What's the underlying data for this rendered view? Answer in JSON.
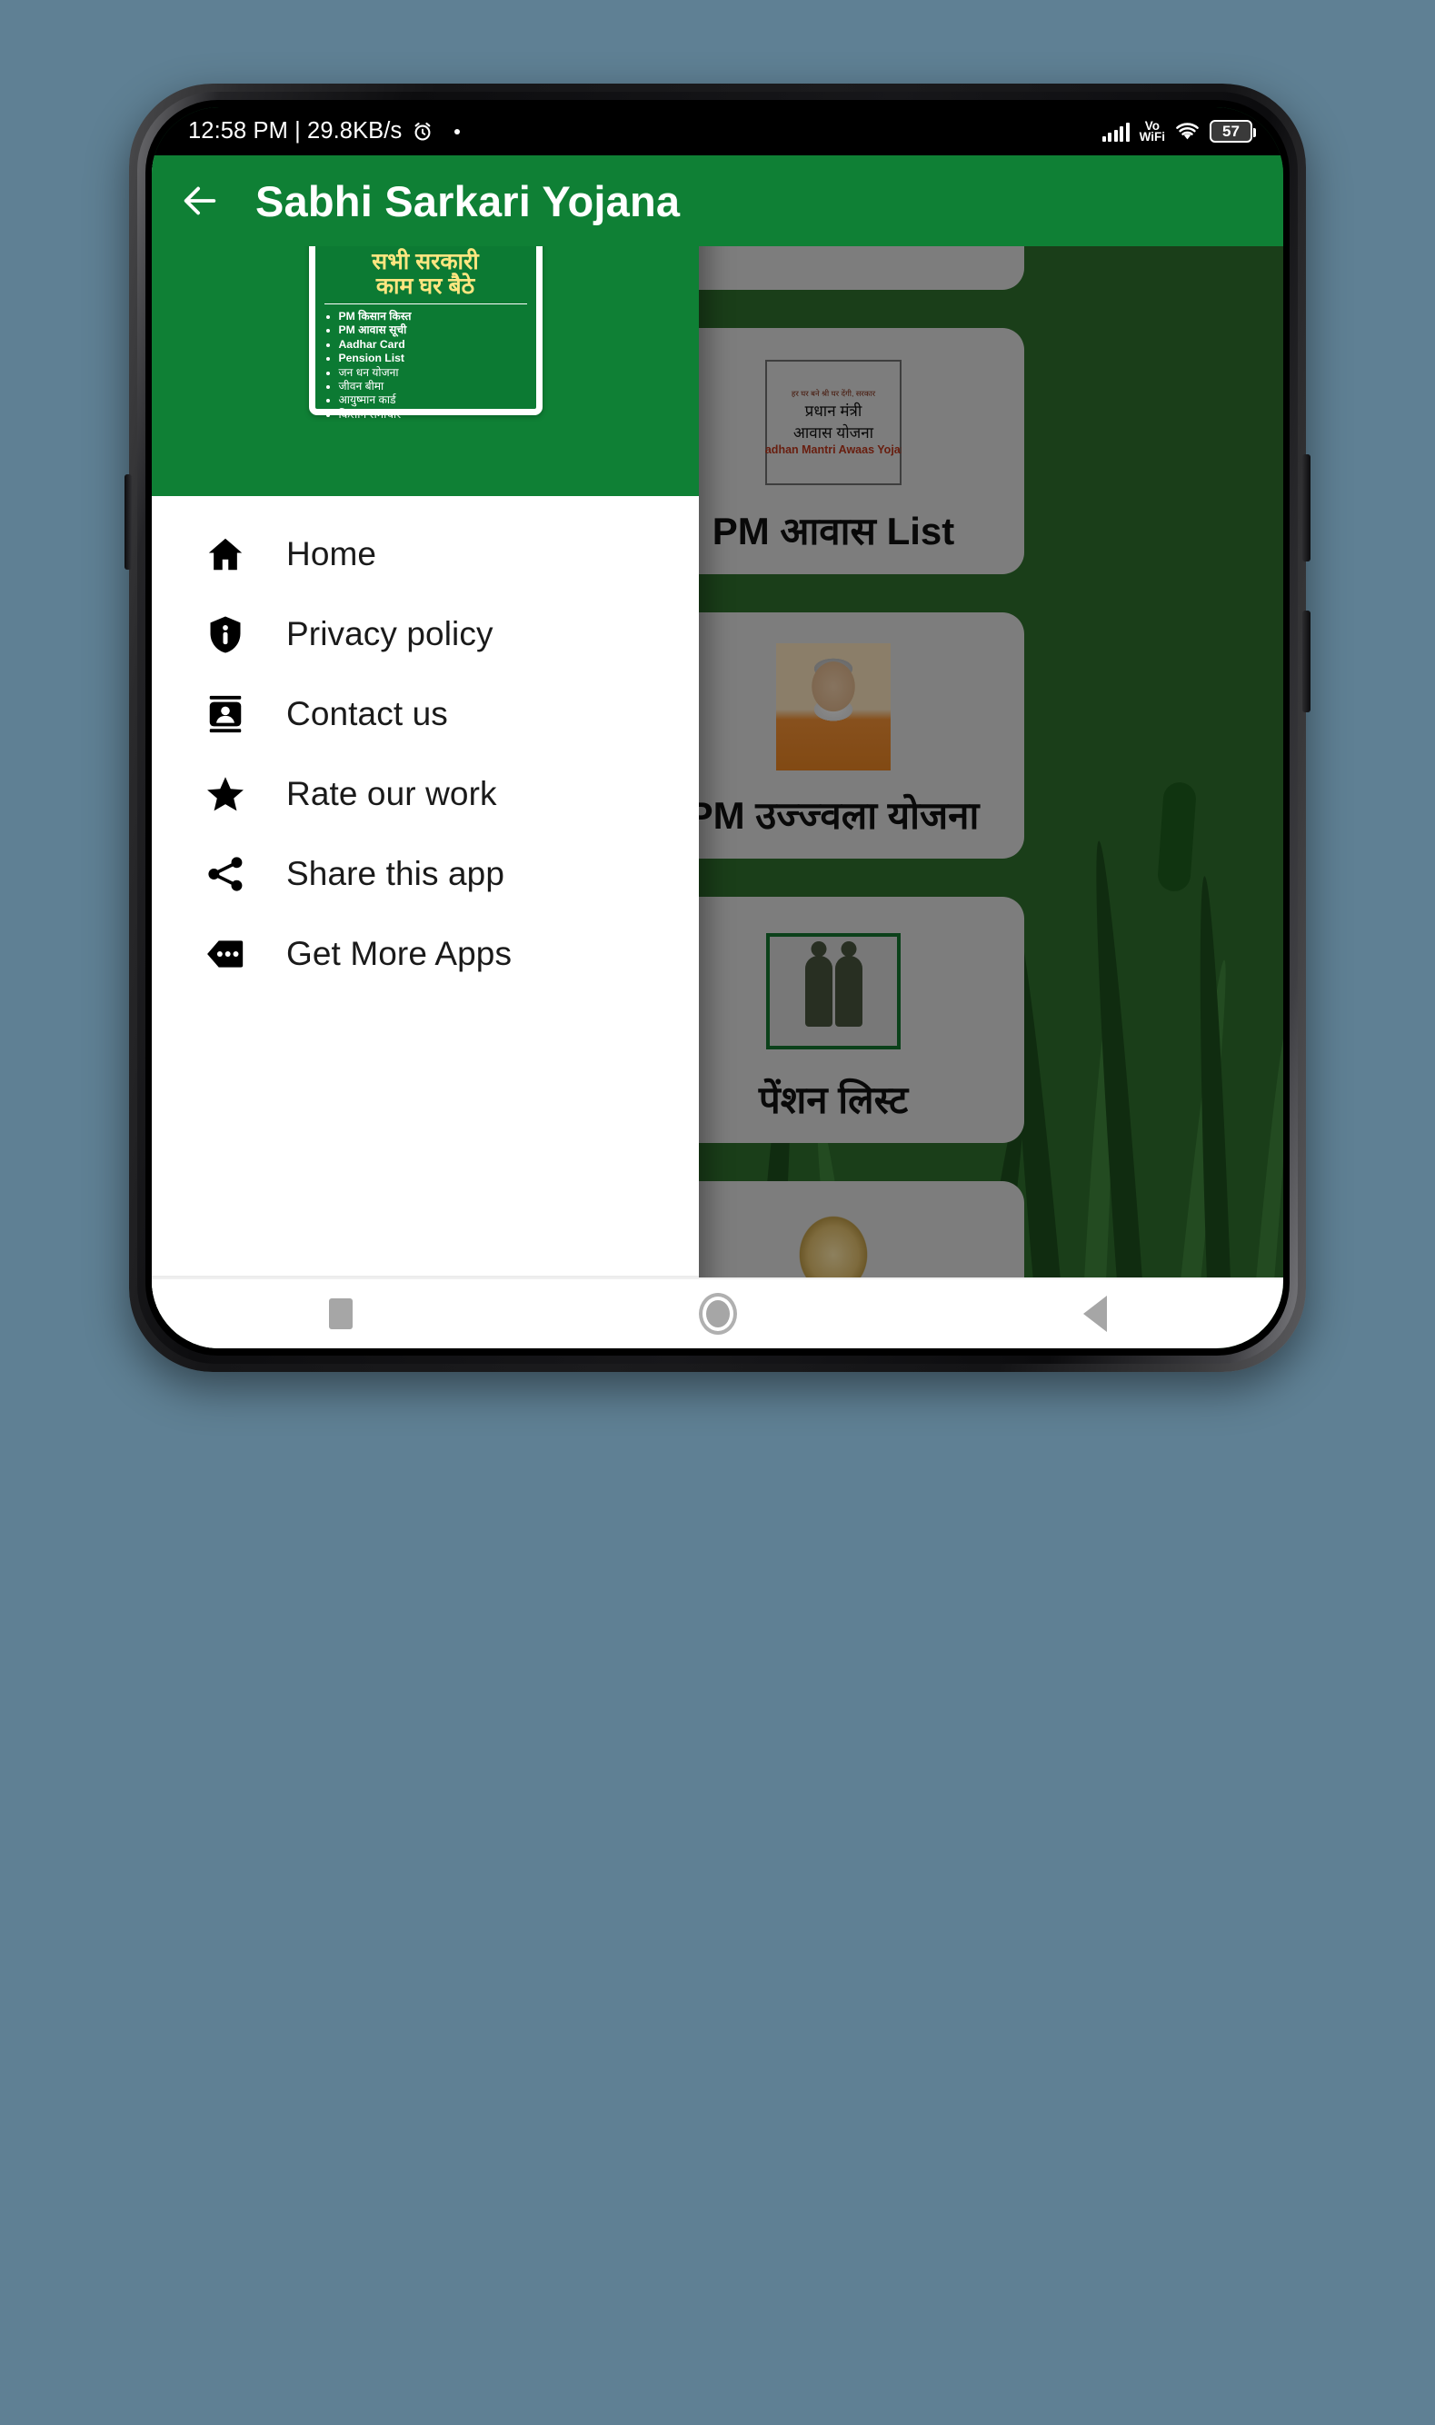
{
  "status_bar": {
    "time_and_net": "12:58 PM | 29.8KB/s",
    "alarm_icon": "alarm-clock-icon",
    "dot_icon": "notification-dot-icon",
    "signal_icon": "cellular-signal-icon",
    "volte_label_line1": "Vo",
    "volte_label_line2": "WiFi",
    "wifi_icon": "wifi-icon",
    "battery_level": "57"
  },
  "app_bar": {
    "back_icon": "back-arrow-icon",
    "title": "Sabhi Sarkari Yojana",
    "background_color": "#0f8035"
  },
  "drawer": {
    "header": {
      "background_color": "#0f8035",
      "logo": {
        "title_line1": "सभी सरकारी",
        "title_line2": "काम घर बैठे",
        "title_color": "#ffe680",
        "items": [
          {
            "text": "PM किसान किस्त",
            "bold": true
          },
          {
            "text": "PM आवास सूची",
            "bold": true
          },
          {
            "text": "Aadhar Card",
            "bold": true
          },
          {
            "text": "Pension List",
            "bold": true
          },
          {
            "text": "जन धन योजना",
            "bold": false
          },
          {
            "text": "जीवन बीमा",
            "bold": false
          },
          {
            "text": "आयुष्मान कार्ड",
            "bold": false
          },
          {
            "text": "किसान समाचार",
            "bold": false
          }
        ]
      }
    },
    "menu_items": [
      {
        "label": "Home",
        "icon": "home-icon"
      },
      {
        "label": "Privacy policy",
        "icon": "shield-info-icon"
      },
      {
        "label": "Contact us",
        "icon": "contact-card-icon"
      },
      {
        "label": "Rate our work",
        "icon": "star-icon"
      },
      {
        "label": "Share this app",
        "icon": "share-icon"
      },
      {
        "label": "Get More Apps",
        "icon": "more-apps-tag-icon"
      }
    ]
  },
  "background_content": {
    "background_color": "#2e6b2c",
    "cards": [
      {
        "label": "PM आवास List",
        "thumb": "pm-awaas-yojana-logo",
        "logo_text": {
          "tagline": "हर घर बने श्री घर देंगी, सरकार",
          "line1": "प्रधान मंत्री",
          "line2": "आवास योजना",
          "english": "Pradhan Mantri Awaas Yojana"
        }
      },
      {
        "label": "PM उज्ज्वला योजना",
        "thumb": "modi-portrait-photo"
      },
      {
        "label": "पेंशन लिस्ट",
        "thumb": "elderly-couple-icon"
      },
      {
        "label": "",
        "thumb": "light-bulb-photo"
      }
    ]
  },
  "nav_bar": {
    "recents_icon": "recents-square-icon",
    "home_icon": "home-circle-icon",
    "back_icon": "back-triangle-icon"
  }
}
